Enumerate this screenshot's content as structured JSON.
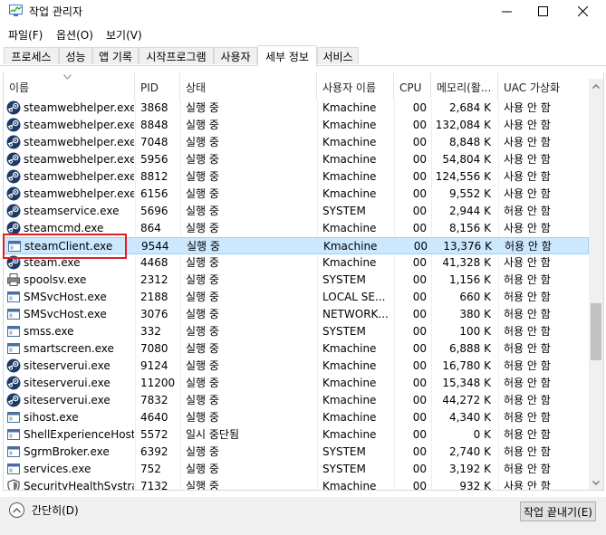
{
  "window": {
    "title": "작업 관리자",
    "controls": {
      "minimize": "—",
      "maximize": "☐",
      "close": "✕"
    }
  },
  "menu": {
    "items": [
      "파일(F)",
      "옵션(O)",
      "보기(V)"
    ]
  },
  "tabs": {
    "items": [
      "프로세스",
      "성능",
      "앱 기록",
      "시작프로그램",
      "사용자",
      "세부 정보",
      "서비스"
    ],
    "active_index": 5
  },
  "columns": {
    "name": "이름",
    "pid": "PID",
    "status": "상태",
    "user": "사용자 이름",
    "cpu": "CPU",
    "memory": "메모리(활...",
    "uac": "UAC 가상화"
  },
  "rows": [
    {
      "name": "steamwebhelper.exe",
      "pid": "3868",
      "status": "실행 중",
      "user": "Kmachine",
      "cpu": "00",
      "memory": "2,684 K",
      "uac": "사용 안 함",
      "icon": "steam-icon"
    },
    {
      "name": "steamwebhelper.exe",
      "pid": "8848",
      "status": "실행 중",
      "user": "Kmachine",
      "cpu": "00",
      "memory": "132,084 K",
      "uac": "사용 안 함",
      "icon": "steam-icon"
    },
    {
      "name": "steamwebhelper.exe",
      "pid": "7048",
      "status": "실행 중",
      "user": "Kmachine",
      "cpu": "00",
      "memory": "8,848 K",
      "uac": "사용 안 함",
      "icon": "steam-icon"
    },
    {
      "name": "steamwebhelper.exe",
      "pid": "5956",
      "status": "실행 중",
      "user": "Kmachine",
      "cpu": "00",
      "memory": "54,804 K",
      "uac": "사용 안 함",
      "icon": "steam-icon"
    },
    {
      "name": "steamwebhelper.exe",
      "pid": "8812",
      "status": "실행 중",
      "user": "Kmachine",
      "cpu": "00",
      "memory": "124,556 K",
      "uac": "사용 안 함",
      "icon": "steam-icon"
    },
    {
      "name": "steamwebhelper.exe",
      "pid": "6156",
      "status": "실행 중",
      "user": "Kmachine",
      "cpu": "00",
      "memory": "9,552 K",
      "uac": "사용 안 함",
      "icon": "steam-icon"
    },
    {
      "name": "steamservice.exe",
      "pid": "5696",
      "status": "실행 중",
      "user": "SYSTEM",
      "cpu": "00",
      "memory": "2,944 K",
      "uac": "허용 안 함",
      "icon": "steam-icon"
    },
    {
      "name": "steamcmd.exe",
      "pid": "864",
      "status": "실행 중",
      "user": "Kmachine",
      "cpu": "00",
      "memory": "8,156 K",
      "uac": "사용 안 함",
      "icon": "steam-icon"
    },
    {
      "name": "steamClient.exe",
      "pid": "9544",
      "status": "실행 중",
      "user": "Kmachine",
      "cpu": "00",
      "memory": "13,376 K",
      "uac": "허용 안 함",
      "icon": "app-window-icon",
      "selected": true
    },
    {
      "name": "steam.exe",
      "pid": "4468",
      "status": "실행 중",
      "user": "Kmachine",
      "cpu": "00",
      "memory": "41,328 K",
      "uac": "사용 안 함",
      "icon": "steam-icon"
    },
    {
      "name": "spoolsv.exe",
      "pid": "2312",
      "status": "실행 중",
      "user": "SYSTEM",
      "cpu": "00",
      "memory": "1,156 K",
      "uac": "허용 안 함",
      "icon": "printer-icon"
    },
    {
      "name": "SMSvcHost.exe",
      "pid": "2188",
      "status": "실행 중",
      "user": "LOCAL SE...",
      "cpu": "00",
      "memory": "660 K",
      "uac": "허용 안 함",
      "icon": "app-window-icon"
    },
    {
      "name": "SMSvcHost.exe",
      "pid": "3076",
      "status": "실행 중",
      "user": "NETWORK...",
      "cpu": "00",
      "memory": "380 K",
      "uac": "허용 안 함",
      "icon": "app-window-icon"
    },
    {
      "name": "smss.exe",
      "pid": "332",
      "status": "실행 중",
      "user": "SYSTEM",
      "cpu": "00",
      "memory": "100 K",
      "uac": "허용 안 함",
      "icon": "app-window-icon"
    },
    {
      "name": "smartscreen.exe",
      "pid": "7080",
      "status": "실행 중",
      "user": "Kmachine",
      "cpu": "00",
      "memory": "6,888 K",
      "uac": "허용 안 함",
      "icon": "app-window-icon"
    },
    {
      "name": "siteserverui.exe",
      "pid": "9124",
      "status": "실행 중",
      "user": "Kmachine",
      "cpu": "00",
      "memory": "16,780 K",
      "uac": "허용 안 함",
      "icon": "steam-icon"
    },
    {
      "name": "siteserverui.exe",
      "pid": "11200",
      "status": "실행 중",
      "user": "Kmachine",
      "cpu": "00",
      "memory": "15,348 K",
      "uac": "허용 안 함",
      "icon": "steam-icon"
    },
    {
      "name": "siteserverui.exe",
      "pid": "7832",
      "status": "실행 중",
      "user": "Kmachine",
      "cpu": "00",
      "memory": "44,272 K",
      "uac": "허용 안 함",
      "icon": "steam-icon"
    },
    {
      "name": "sihost.exe",
      "pid": "4640",
      "status": "실행 중",
      "user": "Kmachine",
      "cpu": "00",
      "memory": "4,340 K",
      "uac": "허용 안 함",
      "icon": "app-window-icon"
    },
    {
      "name": "ShellExperienceHost...",
      "pid": "5572",
      "status": "일시 중단됨",
      "user": "Kmachine",
      "cpu": "00",
      "memory": "0 K",
      "uac": "허용 안 함",
      "icon": "app-window-icon"
    },
    {
      "name": "SgrmBroker.exe",
      "pid": "6392",
      "status": "실행 중",
      "user": "SYSTEM",
      "cpu": "00",
      "memory": "2,740 K",
      "uac": "허용 안 함",
      "icon": "app-window-icon"
    },
    {
      "name": "services.exe",
      "pid": "752",
      "status": "실행 중",
      "user": "SYSTEM",
      "cpu": "00",
      "memory": "3,192 K",
      "uac": "허용 안 함",
      "icon": "app-window-icon"
    },
    {
      "name": "SecurityHealthSystra...",
      "pid": "7132",
      "status": "실행 중",
      "user": "Kmachine",
      "cpu": "00",
      "memory": "932 K",
      "uac": "사용 안 함",
      "icon": "shield-icon"
    }
  ],
  "footer": {
    "fewer_details": "간단히(D)",
    "end_task": "작업 끝내기(E)"
  },
  "colors": {
    "selection_bg": "#cce8ff",
    "selection_border": "#99d1ff",
    "highlight_box": "#e02020",
    "steam_icon": "#1b3a66"
  }
}
